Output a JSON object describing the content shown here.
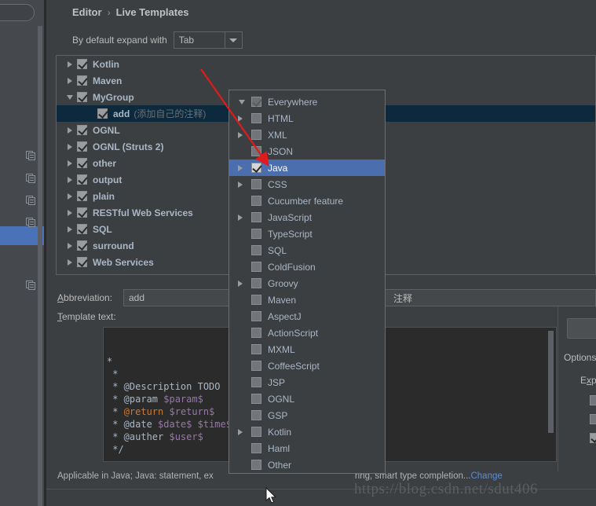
{
  "breadcrumb": {
    "parent": "Editor",
    "separator": "›",
    "current": "Live Templates"
  },
  "expand": {
    "label": "By default expand with",
    "value": "Tab",
    "arrow_icon": "chevron-down-icon"
  },
  "tree": {
    "rows": [
      {
        "label": "Kotlin",
        "desc": "",
        "expander": "right",
        "checked": true,
        "indent": false,
        "selected": false
      },
      {
        "label": "Maven",
        "desc": "",
        "expander": "right",
        "checked": true,
        "indent": false,
        "selected": false
      },
      {
        "label": "MyGroup",
        "desc": "",
        "expander": "down",
        "checked": true,
        "indent": false,
        "selected": false
      },
      {
        "label": "add",
        "desc": "(添加自己的注释)",
        "expander": "none",
        "checked": true,
        "indent": true,
        "selected": true
      },
      {
        "label": "OGNL",
        "desc": "",
        "expander": "right",
        "checked": true,
        "indent": false,
        "selected": false
      },
      {
        "label": "OGNL (Struts 2)",
        "desc": "",
        "expander": "right",
        "checked": true,
        "indent": false,
        "selected": false
      },
      {
        "label": "other",
        "desc": "",
        "expander": "right",
        "checked": true,
        "indent": false,
        "selected": false
      },
      {
        "label": "output",
        "desc": "",
        "expander": "right",
        "checked": true,
        "indent": false,
        "selected": false
      },
      {
        "label": "plain",
        "desc": "",
        "expander": "right",
        "checked": true,
        "indent": false,
        "selected": false
      },
      {
        "label": "RESTful Web Services",
        "desc": "",
        "expander": "right",
        "checked": true,
        "indent": false,
        "selected": false
      },
      {
        "label": "SQL",
        "desc": "",
        "expander": "right",
        "checked": true,
        "indent": false,
        "selected": false
      },
      {
        "label": "surround",
        "desc": "",
        "expander": "right",
        "checked": true,
        "indent": false,
        "selected": false
      },
      {
        "label": "Web Services",
        "desc": "",
        "expander": "right",
        "checked": true,
        "indent": false,
        "selected": false
      }
    ]
  },
  "abbreviation": {
    "label": "Abbreviation:",
    "value": "add"
  },
  "description": {
    "value": "注释"
  },
  "template_text": {
    "label": "Template text:"
  },
  "code": {
    "lines": [
      "*",
      " *",
      " * @Description TODO",
      " * @param $param$",
      " * @return $return$",
      " * @date $date$ $time$",
      " * @auther $user$",
      " */"
    ]
  },
  "options": {
    "title": "Options",
    "expand_label": "Expand with"
  },
  "status": {
    "prefix": "Applicable in Java; Java: statement, ex",
    "suffix": "ring, smart type completion...",
    "change_link": "Change"
  },
  "popup": {
    "rows": [
      {
        "label": "Everywhere",
        "expander": "down",
        "state": "checked-faint",
        "root": true,
        "selected": false
      },
      {
        "label": "HTML",
        "expander": "right",
        "state": "unchecked",
        "root": false,
        "selected": false
      },
      {
        "label": "XML",
        "expander": "right",
        "state": "unchecked",
        "root": false,
        "selected": false
      },
      {
        "label": "JSON",
        "expander": "none",
        "state": "unchecked",
        "root": false,
        "selected": false
      },
      {
        "label": "Java",
        "expander": "right",
        "state": "checked",
        "root": false,
        "selected": true
      },
      {
        "label": "CSS",
        "expander": "right",
        "state": "unchecked",
        "root": false,
        "selected": false
      },
      {
        "label": "Cucumber feature",
        "expander": "none",
        "state": "unchecked",
        "root": false,
        "selected": false
      },
      {
        "label": "JavaScript",
        "expander": "right",
        "state": "unchecked",
        "root": false,
        "selected": false
      },
      {
        "label": "TypeScript",
        "expander": "none",
        "state": "unchecked",
        "root": false,
        "selected": false
      },
      {
        "label": "SQL",
        "expander": "none",
        "state": "unchecked",
        "root": false,
        "selected": false
      },
      {
        "label": "ColdFusion",
        "expander": "none",
        "state": "unchecked",
        "root": false,
        "selected": false
      },
      {
        "label": "Groovy",
        "expander": "right",
        "state": "unchecked",
        "root": false,
        "selected": false
      },
      {
        "label": "Maven",
        "expander": "none",
        "state": "unchecked",
        "root": false,
        "selected": false
      },
      {
        "label": "AspectJ",
        "expander": "none",
        "state": "unchecked",
        "root": false,
        "selected": false
      },
      {
        "label": "ActionScript",
        "expander": "none",
        "state": "unchecked",
        "root": false,
        "selected": false
      },
      {
        "label": "MXML",
        "expander": "none",
        "state": "unchecked",
        "root": false,
        "selected": false
      },
      {
        "label": "CoffeeScript",
        "expander": "none",
        "state": "unchecked",
        "root": false,
        "selected": false
      },
      {
        "label": "JSP",
        "expander": "none",
        "state": "unchecked",
        "root": false,
        "selected": false
      },
      {
        "label": "OGNL",
        "expander": "none",
        "state": "unchecked",
        "root": false,
        "selected": false
      },
      {
        "label": "GSP",
        "expander": "none",
        "state": "unchecked",
        "root": false,
        "selected": false
      },
      {
        "label": "Kotlin",
        "expander": "right",
        "state": "unchecked",
        "root": false,
        "selected": false
      },
      {
        "label": "Haml",
        "expander": "none",
        "state": "unchecked",
        "root": false,
        "selected": false
      },
      {
        "label": "Other",
        "expander": "none",
        "state": "unchecked",
        "root": false,
        "selected": false
      }
    ]
  },
  "watermark": {
    "text": "https://blog.csdn.net/sdut406"
  },
  "colors": {
    "background": "#3c3f41",
    "sidebar": "#45484d",
    "selection_blue": "#4b6eaf",
    "tree_selection": "#0d293e",
    "sidebar_selection": "#4a72b8",
    "link": "#5b8dd9",
    "annotation_red": "#e01b1b",
    "editor_bg": "#2b2b2b",
    "code_variable": "#9876aa",
    "code_keyword": "#cc7832"
  }
}
